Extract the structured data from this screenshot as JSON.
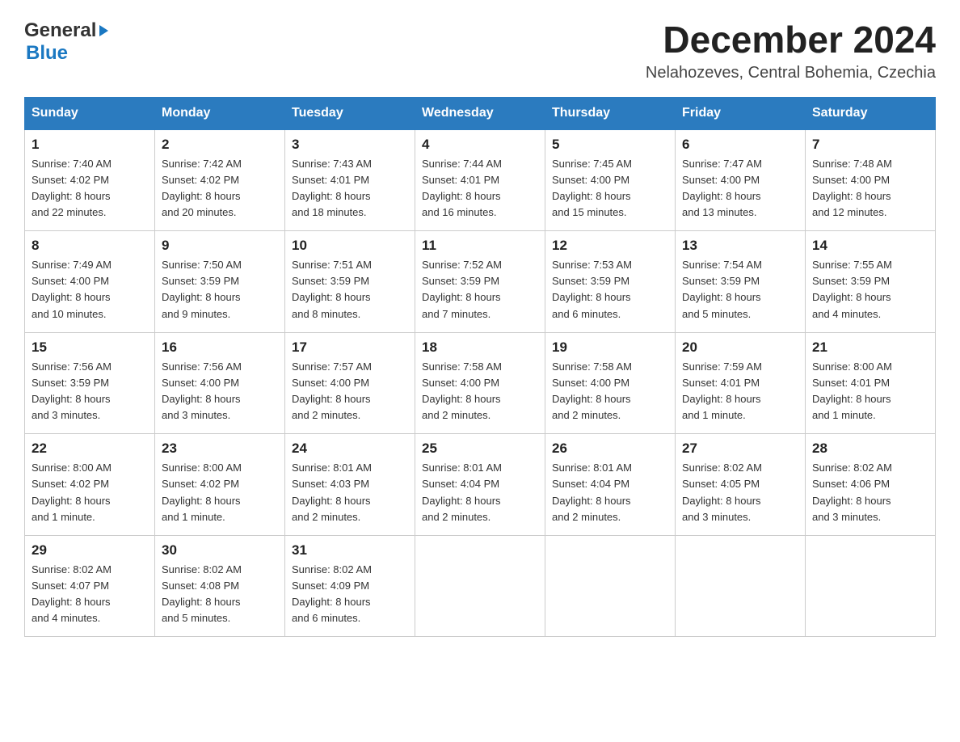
{
  "header": {
    "logo_general": "General",
    "logo_blue": "Blue",
    "month_title": "December 2024",
    "location": "Nelahozeves, Central Bohemia, Czechia"
  },
  "days_of_week": [
    "Sunday",
    "Monday",
    "Tuesday",
    "Wednesday",
    "Thursday",
    "Friday",
    "Saturday"
  ],
  "weeks": [
    [
      {
        "day": "1",
        "sunrise": "7:40 AM",
        "sunset": "4:02 PM",
        "daylight": "8 hours and 22 minutes."
      },
      {
        "day": "2",
        "sunrise": "7:42 AM",
        "sunset": "4:02 PM",
        "daylight": "8 hours and 20 minutes."
      },
      {
        "day": "3",
        "sunrise": "7:43 AM",
        "sunset": "4:01 PM",
        "daylight": "8 hours and 18 minutes."
      },
      {
        "day": "4",
        "sunrise": "7:44 AM",
        "sunset": "4:01 PM",
        "daylight": "8 hours and 16 minutes."
      },
      {
        "day": "5",
        "sunrise": "7:45 AM",
        "sunset": "4:00 PM",
        "daylight": "8 hours and 15 minutes."
      },
      {
        "day": "6",
        "sunrise": "7:47 AM",
        "sunset": "4:00 PM",
        "daylight": "8 hours and 13 minutes."
      },
      {
        "day": "7",
        "sunrise": "7:48 AM",
        "sunset": "4:00 PM",
        "daylight": "8 hours and 12 minutes."
      }
    ],
    [
      {
        "day": "8",
        "sunrise": "7:49 AM",
        "sunset": "4:00 PM",
        "daylight": "8 hours and 10 minutes."
      },
      {
        "day": "9",
        "sunrise": "7:50 AM",
        "sunset": "3:59 PM",
        "daylight": "8 hours and 9 minutes."
      },
      {
        "day": "10",
        "sunrise": "7:51 AM",
        "sunset": "3:59 PM",
        "daylight": "8 hours and 8 minutes."
      },
      {
        "day": "11",
        "sunrise": "7:52 AM",
        "sunset": "3:59 PM",
        "daylight": "8 hours and 7 minutes."
      },
      {
        "day": "12",
        "sunrise": "7:53 AM",
        "sunset": "3:59 PM",
        "daylight": "8 hours and 6 minutes."
      },
      {
        "day": "13",
        "sunrise": "7:54 AM",
        "sunset": "3:59 PM",
        "daylight": "8 hours and 5 minutes."
      },
      {
        "day": "14",
        "sunrise": "7:55 AM",
        "sunset": "3:59 PM",
        "daylight": "8 hours and 4 minutes."
      }
    ],
    [
      {
        "day": "15",
        "sunrise": "7:56 AM",
        "sunset": "3:59 PM",
        "daylight": "8 hours and 3 minutes."
      },
      {
        "day": "16",
        "sunrise": "7:56 AM",
        "sunset": "4:00 PM",
        "daylight": "8 hours and 3 minutes."
      },
      {
        "day": "17",
        "sunrise": "7:57 AM",
        "sunset": "4:00 PM",
        "daylight": "8 hours and 2 minutes."
      },
      {
        "day": "18",
        "sunrise": "7:58 AM",
        "sunset": "4:00 PM",
        "daylight": "8 hours and 2 minutes."
      },
      {
        "day": "19",
        "sunrise": "7:58 AM",
        "sunset": "4:00 PM",
        "daylight": "8 hours and 2 minutes."
      },
      {
        "day": "20",
        "sunrise": "7:59 AM",
        "sunset": "4:01 PM",
        "daylight": "8 hours and 1 minute."
      },
      {
        "day": "21",
        "sunrise": "8:00 AM",
        "sunset": "4:01 PM",
        "daylight": "8 hours and 1 minute."
      }
    ],
    [
      {
        "day": "22",
        "sunrise": "8:00 AM",
        "sunset": "4:02 PM",
        "daylight": "8 hours and 1 minute."
      },
      {
        "day": "23",
        "sunrise": "8:00 AM",
        "sunset": "4:02 PM",
        "daylight": "8 hours and 1 minute."
      },
      {
        "day": "24",
        "sunrise": "8:01 AM",
        "sunset": "4:03 PM",
        "daylight": "8 hours and 2 minutes."
      },
      {
        "day": "25",
        "sunrise": "8:01 AM",
        "sunset": "4:04 PM",
        "daylight": "8 hours and 2 minutes."
      },
      {
        "day": "26",
        "sunrise": "8:01 AM",
        "sunset": "4:04 PM",
        "daylight": "8 hours and 2 minutes."
      },
      {
        "day": "27",
        "sunrise": "8:02 AM",
        "sunset": "4:05 PM",
        "daylight": "8 hours and 3 minutes."
      },
      {
        "day": "28",
        "sunrise": "8:02 AM",
        "sunset": "4:06 PM",
        "daylight": "8 hours and 3 minutes."
      }
    ],
    [
      {
        "day": "29",
        "sunrise": "8:02 AM",
        "sunset": "4:07 PM",
        "daylight": "8 hours and 4 minutes."
      },
      {
        "day": "30",
        "sunrise": "8:02 AM",
        "sunset": "4:08 PM",
        "daylight": "8 hours and 5 minutes."
      },
      {
        "day": "31",
        "sunrise": "8:02 AM",
        "sunset": "4:09 PM",
        "daylight": "8 hours and 6 minutes."
      },
      null,
      null,
      null,
      null
    ]
  ],
  "labels": {
    "sunrise_prefix": "Sunrise: ",
    "sunset_prefix": "Sunset: ",
    "daylight_prefix": "Daylight: "
  }
}
